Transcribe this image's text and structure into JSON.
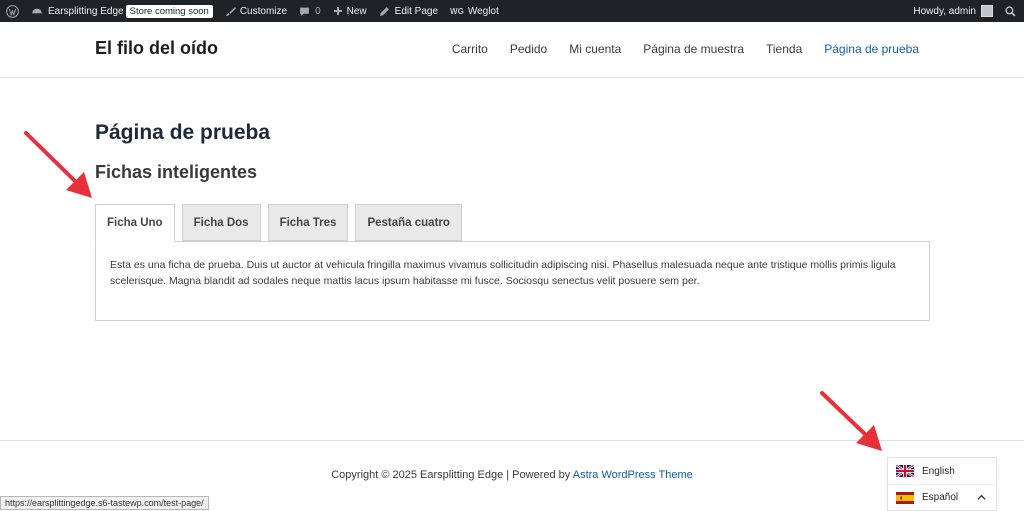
{
  "admin_bar": {
    "site_name": "Earsplitting Edge",
    "store_badge": "Store coming soon",
    "customize": "Customize",
    "comments_count": "0",
    "new": "New",
    "edit_page": "Edit Page",
    "weglot": "Weglot",
    "weglot_logo": "WG",
    "howdy": "Howdy, admin"
  },
  "header": {
    "site_title": "El filo del oído",
    "nav": [
      "Carrito",
      "Pedido",
      "Mi cuenta",
      "Página de muestra",
      "Tienda",
      "Página de prueba"
    ],
    "active_nav": "Página de prueba"
  },
  "main": {
    "page_title": "Página de prueba",
    "section_title": "Fichas inteligentes",
    "tabs": [
      "Ficha Uno",
      "Ficha Dos",
      "Ficha Tres",
      "Pestaña cuatro"
    ],
    "active_tab": "Ficha Uno",
    "tab_content": "Esta es una ficha de prueba. Duis ut auctor at vehicula fringilla maximus vivamus sollicitudin adipiscing nisi. Phasellus malesuada neque ante tristique mollis primis ligula scelerisque. Magna blandit ad sodales neque mattis lacus ipsum habitasse mi fusce. Sociosqu senectus velit posuere sem per."
  },
  "footer": {
    "copyright_prefix": "Copyright © 2025 Earsplitting Edge | Powered by ",
    "theme_link": "Astra WordPress Theme"
  },
  "status_url": "https://earsplittingedge.s6-tastewp.com/test-page/",
  "language_switcher": {
    "languages": [
      "English",
      "Español"
    ],
    "current": "Español"
  },
  "colors": {
    "admin_bar_bg": "#1d2327",
    "link": "#0f5fa8",
    "annotation_arrow": "#e8303a"
  },
  "icons": [
    "wordpress-logo-icon",
    "dashboard-icon",
    "brush-icon",
    "comment-icon",
    "plus-icon",
    "pencil-icon",
    "search-icon",
    "uk-flag-icon",
    "spain-flag-icon",
    "chevron-up-icon",
    "annotation-arrow-icon"
  ]
}
